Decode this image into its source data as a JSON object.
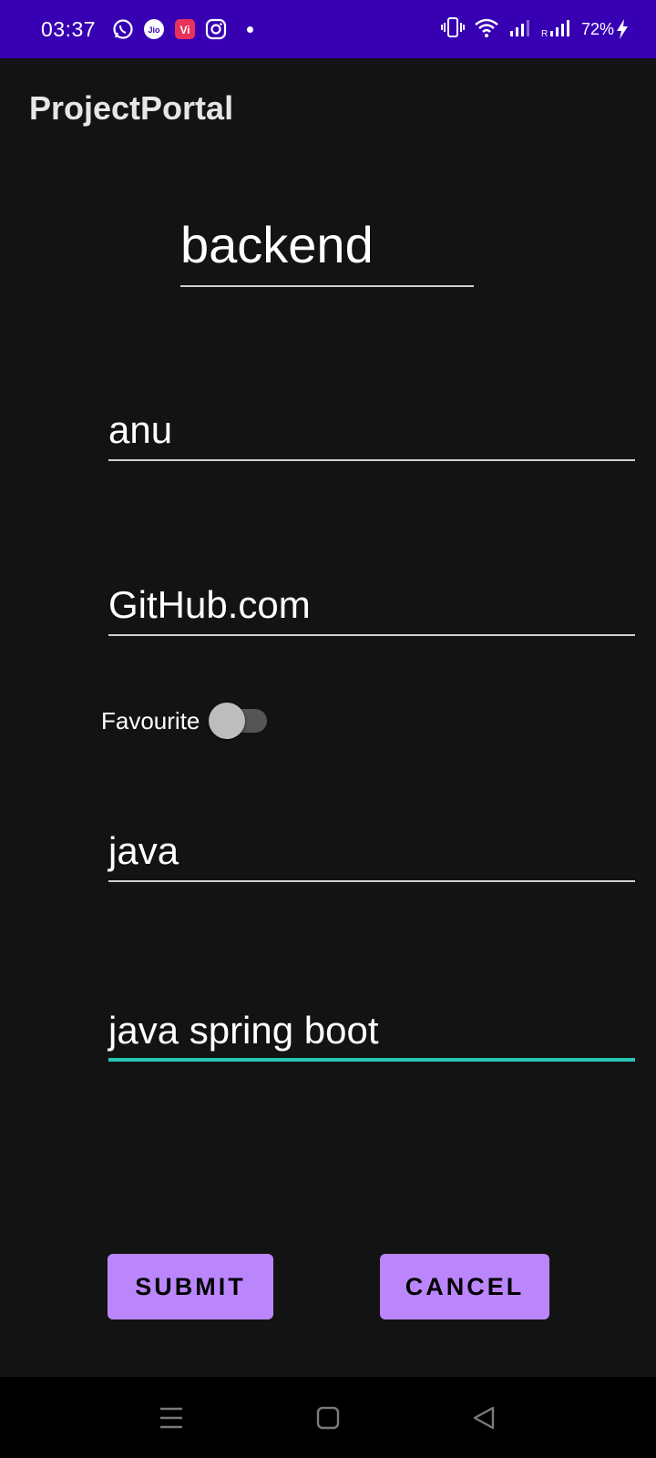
{
  "status_bar": {
    "time": "03:37",
    "battery": "72%",
    "background_color": "#3700b3",
    "app_icons": [
      "whatsapp-icon",
      "jio-icon",
      "vi-icon",
      "instagram-icon"
    ],
    "system_icons": [
      "vibrate-icon",
      "wifi-icon",
      "signal-icon",
      "signal-roaming-icon",
      "charging-icon"
    ]
  },
  "app_bar": {
    "title": "ProjectPortal"
  },
  "form": {
    "project_name": "backend",
    "owner": "anu",
    "link": "GitHub.com",
    "favourite_label": "Favourite",
    "favourite_on": false,
    "language": "java",
    "description": "java spring boot",
    "focused_field": "description",
    "accent_color": "#26c6b0"
  },
  "buttons": {
    "submit_label": "SUBMIT",
    "cancel_label": "CANCEL",
    "color": "#bb86fc"
  },
  "nav_bar": {
    "icons": [
      "menu-icon",
      "home-icon",
      "back-icon"
    ]
  }
}
